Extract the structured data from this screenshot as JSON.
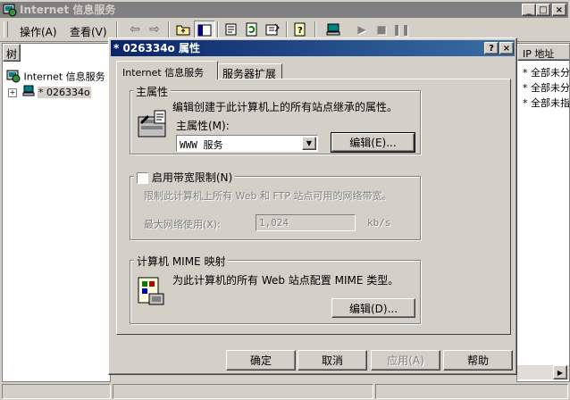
{
  "main_window": {
    "title": "Internet 信息服务",
    "menu": [
      "操作(A)",
      "查看(V)"
    ],
    "tree_header": "树",
    "tree_root": "Internet 信息服务",
    "tree_node": "* 026334o",
    "column_header": "IP 地址",
    "list_rows": [
      "* 全部未分",
      "* 全部未分",
      "* 全部未指"
    ]
  },
  "dialog": {
    "title": "* 026334o 属性",
    "tabs": [
      "Internet 信息服务",
      "服务器扩展"
    ],
    "master_props": {
      "legend": "主属性",
      "description": "编辑创建于此计算机上的所有站点继承的属性。",
      "select_label": "主属性(M):",
      "select_value": "WWW 服务",
      "edit_button": "编辑(E)..."
    },
    "bandwidth": {
      "checkbox_label": "启用带宽限制(N)",
      "description": "限制此计算机上所有 Web 和 FTP 站点可用的网络带宽。",
      "max_label": "最大网络使用(X):",
      "max_value": "1,024",
      "unit": "kb/s"
    },
    "mime": {
      "legend": "计算机 MIME 映射",
      "description": "为此计算机的所有 Web 站点配置 MIME 类型。",
      "edit_button": "编辑(D)..."
    },
    "buttons": {
      "ok": "确定",
      "cancel": "取消",
      "apply": "应用(A)",
      "help": "帮助"
    }
  },
  "colors": {
    "active_title": "#0a246a",
    "inactive_title": "#808080",
    "face": "#d4d0c8"
  }
}
